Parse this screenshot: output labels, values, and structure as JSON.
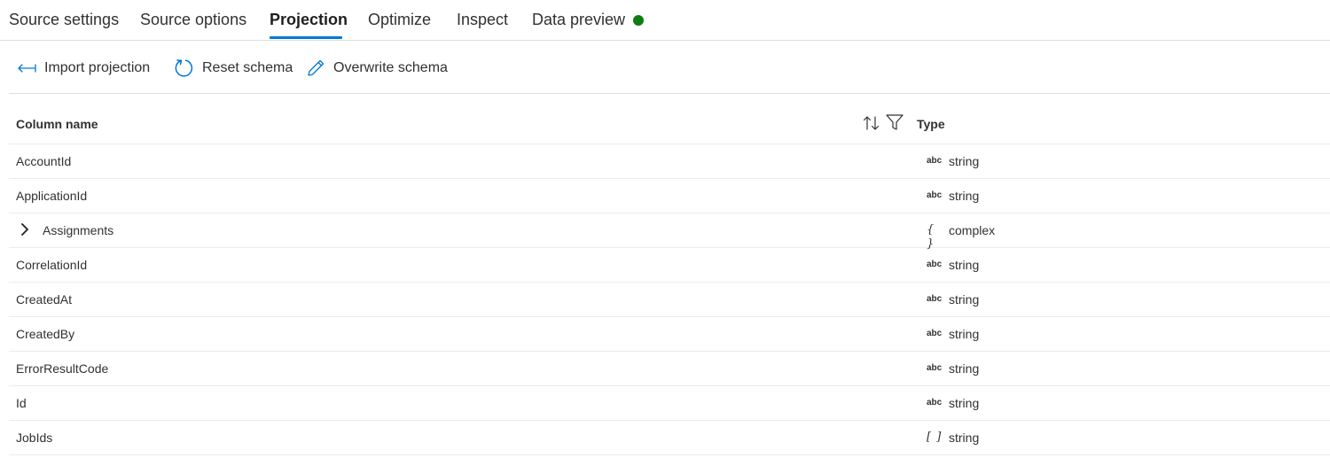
{
  "tabs": {
    "items": [
      {
        "label": "Source settings"
      },
      {
        "label": "Source options"
      },
      {
        "label": "Projection"
      },
      {
        "label": "Optimize"
      },
      {
        "label": "Inspect"
      },
      {
        "label": "Data preview"
      }
    ],
    "active": "Projection",
    "status_color": "#107c10",
    "accent_color": "#0078d4"
  },
  "toolbar": {
    "import_label": "Import projection",
    "import_icon": "import-arrow-icon",
    "reset_label": "Reset schema",
    "reset_icon": "refresh-icon",
    "overwrite_label": "Overwrite schema",
    "overwrite_icon": "pencil-icon"
  },
  "table": {
    "col_name_header": "Column name",
    "col_type_header": "Type",
    "rows": [
      {
        "name": "AccountId",
        "type_icon": "abc",
        "type": "string"
      },
      {
        "name": "ApplicationId",
        "type_icon": "abc",
        "type": "string"
      },
      {
        "name": "Assignments",
        "type_icon": "{ }",
        "type": "complex",
        "expandable": true
      },
      {
        "name": "CorrelationId",
        "type_icon": "abc",
        "type": "string"
      },
      {
        "name": "CreatedAt",
        "type_icon": "abc",
        "type": "string"
      },
      {
        "name": "CreatedBy",
        "type_icon": "abc",
        "type": "string"
      },
      {
        "name": "ErrorResultCode",
        "type_icon": "abc",
        "type": "string"
      },
      {
        "name": "Id",
        "type_icon": "abc",
        "type": "string"
      },
      {
        "name": "JobIds",
        "type_icon": "[ ]",
        "type": "string"
      }
    ]
  }
}
